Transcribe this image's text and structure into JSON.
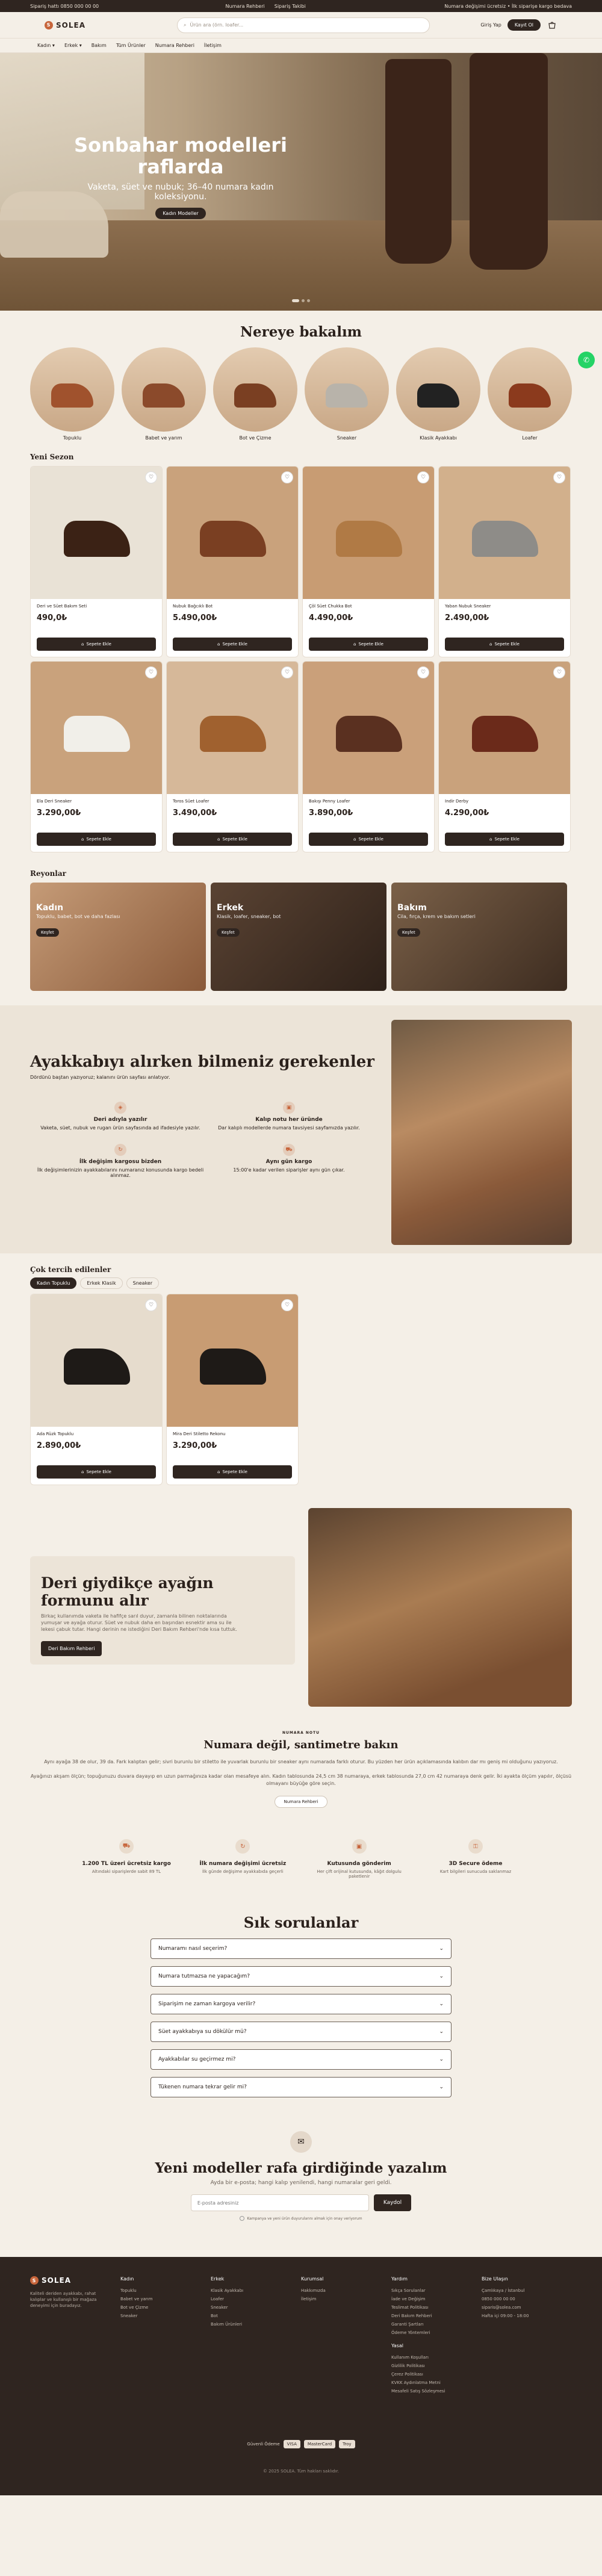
{
  "topbar": {
    "left": "Sipariş hattı 0850 000 00 00",
    "mid": [
      "Numara Rehberi",
      "Sipariş Takibi"
    ],
    "right": "Numara değişimi ücretsiz • İlk siparişe kargo bedava"
  },
  "header": {
    "logo": "SOLEA",
    "search_placeholder": "Ürün ara (örn. loafer...",
    "login": "Giriş Yap",
    "signup": "Kayıt Ol"
  },
  "nav": [
    "Kadın",
    "Erkek",
    "Bakım",
    "Tüm Ürünler",
    "Numara Rehberi",
    "İletişim"
  ],
  "hero": {
    "title": "Sonbahar modelleri raflarda",
    "subtitle": "Vaketa, süet ve nubuk; 36–40 numara kadın koleksiyonu.",
    "cta": "Kadın Modeller"
  },
  "categories_title": "Nereye bakalım",
  "circle_cats": [
    "Topuklu",
    "Babet ve yarım",
    "Bot ve Çizme",
    "Sneaker",
    "Klasik Ayakkabı",
    "Loafer"
  ],
  "new_title": "Yeni Sezon",
  "products": [
    {
      "name": "Deri ve Süet Bakım Seti",
      "price": "490,0₺"
    },
    {
      "name": "Nubuk Bağcıklı Bot",
      "price": "5.490,00₺"
    },
    {
      "name": "Çöl Süet Chukka Bot",
      "price": "4.490,00₺"
    },
    {
      "name": "Yaban Nubuk Sneaker",
      "price": "2.490,00₺"
    },
    {
      "name": "Ela Deri Sneaker",
      "price": "3.290,00₺"
    },
    {
      "name": "Toros Süet Loafer",
      "price": "3.490,00₺"
    },
    {
      "name": "Bakışı Penny Loafer",
      "price": "3.890,00₺"
    },
    {
      "name": "Indir Derby",
      "price": "4.290,00₺"
    }
  ],
  "add_label": "Sepete Ekle",
  "collections_title": "Reyonlar",
  "collections": [
    {
      "title": "Kadın",
      "desc": "Topuklu, babet, bot ve daha fazlası",
      "btn": "Keşfet"
    },
    {
      "title": "Erkek",
      "desc": "Klasik, loafer, sneaker, bot",
      "btn": "Keşfet"
    },
    {
      "title": "Bakım",
      "desc": "Cila, fırça, krem ve bakım setleri",
      "btn": "Keşfet"
    }
  ],
  "info": {
    "title": "Ayakkabıyı alırken bilmeniz gerekenler",
    "sub": "Dördünü baştan yazıyoruz; kalanını ürün sayfası anlatıyor.",
    "items": [
      {
        "t": "Deri adıyla yazılır",
        "d": "Vaketa, süet, nubuk ve rugan ürün sayfasında ad ifadesiyle yazılır."
      },
      {
        "t": "Kalıp notu her üründe",
        "d": "Dar kalıplı modellerde numara tavsiyesi sayfamızda yazılır."
      },
      {
        "t": "İlk değişim kargosu bizden",
        "d": "İlk değişimlerinizin ayakkabılarını numaranız konusunda kargo bedeli alınmaz."
      },
      {
        "t": "Aynı gün kargo",
        "d": "15:00'e kadar verilen siparişler aynı gün çıkar."
      }
    ]
  },
  "bestsellers": {
    "title": "Çok tercih edilenler",
    "tabs": [
      "Kadın Topuklu",
      "Erkek Klasik",
      "Sneaker"
    ],
    "items": [
      {
        "name": "Ada Rüzk Topuklu",
        "price": "2.890,00₺"
      },
      {
        "name": "Mira Deri Stiletto Rekonu",
        "price": "3.290,00₺"
      }
    ]
  },
  "promo": {
    "title": "Deri giydikçe ayağın formunu alır",
    "text": "Birkaç kullanımda vaketa ile hafifçe sarıl duyur, zamanla bilinen noktalarında yumuşar ve ayağa oturur. Süet ve nubuk daha en başından esnektir ama su ile lekesi çabuk tutar. Hangi derinin ne istediğini Deri Bakım Rehberi'nde kısa tuttuk.",
    "btn": "Deri Bakım Rehberi"
  },
  "guide": {
    "kicker": "NUMARA NOTU",
    "title": "Numara değil, santimetre bakın",
    "p1": "Aynı ayağa 38 de olur, 39 da. Fark kalıptan gelir; sivri burunlu bir stiletto ile yuvarlak burunlu bir sneaker aynı numarada farklı oturur. Bu yüzden her ürün açıklamasında kalıbın dar mı geniş mi olduğunu yazıyoruz.",
    "p2": "Ayağınızı akşam ölçün; topuğunuzu duvara dayayıp en uzun parmağınıza kadar olan mesafeye alın. Kadın tablosunda 24,5 cm 38 numaraya, erkek tablosunda 27,0 cm 42 numaraya denk gelir. İki ayakta ölçüm yapılır, ölçüsü olmayanı büyüğe göre seçin.",
    "btn": "Numara Rehberi"
  },
  "features": [
    {
      "t": "1.200 TL üzeri ücretsiz kargo",
      "d": "Altındaki siparişlerde sabit 89 TL"
    },
    {
      "t": "İlk numara değişimi ücretsiz",
      "d": "İlk günde değişime ayakkabıda geçerli"
    },
    {
      "t": "Kutusunda gönderim",
      "d": "Her çift orijinal kutusunda, kâğıt dolgulu paketlenir"
    },
    {
      "t": "3D Secure ödeme",
      "d": "Kart bilgileri sunucuda saklanmaz"
    }
  ],
  "faq": {
    "title": "Sık sorulanlar",
    "items": [
      "Numaramı nasıl seçerim?",
      "Numara tutmazsa ne yapacağım?",
      "Siparişim ne zaman kargoya verilir?",
      "Süet ayakkabıya su dökülür mü?",
      "Ayakkabılar su geçirmez mi?",
      "Tükenen numara tekrar gelir mi?"
    ]
  },
  "newsletter": {
    "title": "Yeni modeller rafa girdiğinde yazalım",
    "sub": "Ayda bir e-posta; hangi kalıp yenilendi, hangi numaralar geri geldi.",
    "placeholder": "E-posta adresiniz",
    "btn": "Kaydol",
    "note": "Kampanya ve yeni ürün duyurularını almak için onay veriyorum"
  },
  "footer": {
    "brand": "SOLEA",
    "about": "Kaliteli deriden ayakkabı, rahat kalıplar ve kullanışlı bir mağaza deneyimi için buradayız.",
    "cols": [
      {
        "h": "Kadın",
        "items": [
          "Topuklu",
          "Babet ve yarım",
          "Bot ve Çizme",
          "Sneaker"
        ]
      },
      {
        "h": "Erkek",
        "items": [
          "Klasik Ayakkabı",
          "Loafer",
          "Sneaker",
          "Bot",
          "Bakım Ürünleri"
        ]
      },
      {
        "h": "Kurumsal",
        "items": [
          "Hakkımızda",
          "İletişim"
        ]
      },
      {
        "h": "Yardım",
        "items": [
          "Sıkça Sorulanlar",
          "İade ve Değişim",
          "Teslimat Politikası",
          "Deri Bakım Rehberi",
          "Garanti Şartları",
          "Ödeme Yöntemleri"
        ]
      },
      {
        "h": "Bize Ulaşın",
        "items": [
          "Çamlıkaya / İstanbul",
          "0850 000 00 00",
          "siparis@solea.com",
          "Hafta içi 09:00 - 18:00"
        ]
      }
    ],
    "legal_title": "Yasal",
    "legal": [
      "Kullanım Koşulları",
      "Gizlilik Politikası",
      "Çerez Politikası",
      "KVKK Aydınlatma Metni",
      "Mesafeli Satış Sözleşmesi"
    ],
    "pay_label": "Güvenli Ödeme",
    "pay": [
      "VISA",
      "MasterCard",
      "Troy"
    ],
    "copy": "© 2025 SOLEA. Tüm hakları saklıdır."
  },
  "colors": {
    "dark": "#2f2520",
    "accent": "#c7653b",
    "bg": "#f4efe7",
    "whatsapp": "#25d366"
  }
}
